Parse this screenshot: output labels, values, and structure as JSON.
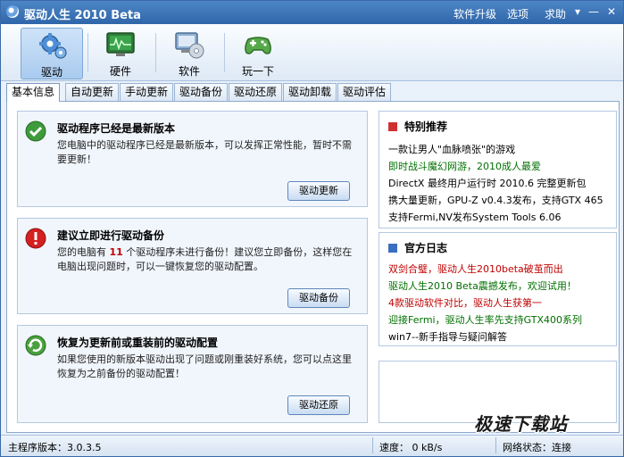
{
  "window": {
    "title": "驱动人生 2010 Beta",
    "menu": [
      "软件升级",
      "选项",
      "求助"
    ]
  },
  "toolbar": {
    "items": [
      {
        "label": "驱动",
        "icon": "gear-icon"
      },
      {
        "label": "硬件",
        "icon": "monitor-chart-icon"
      },
      {
        "label": "软件",
        "icon": "computer-disc-icon"
      },
      {
        "label": "玩一下",
        "icon": "gamepad-icon"
      }
    ]
  },
  "tabs": [
    "基本信息",
    "自动更新",
    "手动更新",
    "驱动备份",
    "驱动还原",
    "驱动卸载",
    "驱动评估"
  ],
  "panels": [
    {
      "title": "驱动程序已经是最新版本",
      "desc": "您电脑中的驱动程序已经是最新版本，可以发挥正常性能，暂时不需要更新！",
      "button": "驱动更新",
      "icon": "check-icon"
    },
    {
      "title": "建议立即进行驱动备份",
      "desc_pre": "您的电脑有 ",
      "desc_num": "11",
      "desc_post": " 个驱动程序未进行备份！建议您立即备份，这样您在电脑出现问题时，可以一键恢复您的驱动配置。",
      "button": "驱动备份",
      "icon": "warning-icon"
    },
    {
      "title": "恢复为更新前或重装前的驱动配置",
      "desc": "如果您使用的新版本驱动出现了问题或刚重装好系统，您可以点这里恢复为之前备份的驱动配置！",
      "button": "驱动还原",
      "icon": "restore-icon"
    }
  ],
  "recommend": {
    "title": "特别推荐",
    "items": [
      {
        "text": "一款让男人\"血脉喷张\"的游戏",
        "color": "black"
      },
      {
        "text": "即时战斗魔幻网游，2010成人最爱",
        "color": "green"
      },
      {
        "text": "DirectX 最终用户运行时 2010.6 完整更新包",
        "color": "black"
      },
      {
        "text": "携大量更新，GPU-Z v0.4.3发布，支持GTX 465",
        "color": "black"
      },
      {
        "text": "支持Fermi,NV发布System Tools 6.06",
        "color": "black"
      }
    ]
  },
  "blog": {
    "title": "官方日志",
    "items": [
      {
        "text": "双剑合璧，驱动人生2010beta破茧而出",
        "color": "red"
      },
      {
        "text": "驱动人生2010 Beta震撼发布，欢迎试用！",
        "color": "green"
      },
      {
        "text": "4款驱动软件对比，驱动人生获第一",
        "color": "red"
      },
      {
        "text": "迎接Fermi，驱动人生率先支持GTX400系列",
        "color": "green"
      },
      {
        "text": "win7--新手指导与疑问解答",
        "color": "black"
      }
    ]
  },
  "status": {
    "version": "主程序版本：3.0.3.5",
    "speed": "速度：  0 kB/s",
    "network": "网络状态：连接"
  },
  "watermark": "极速下载站"
}
